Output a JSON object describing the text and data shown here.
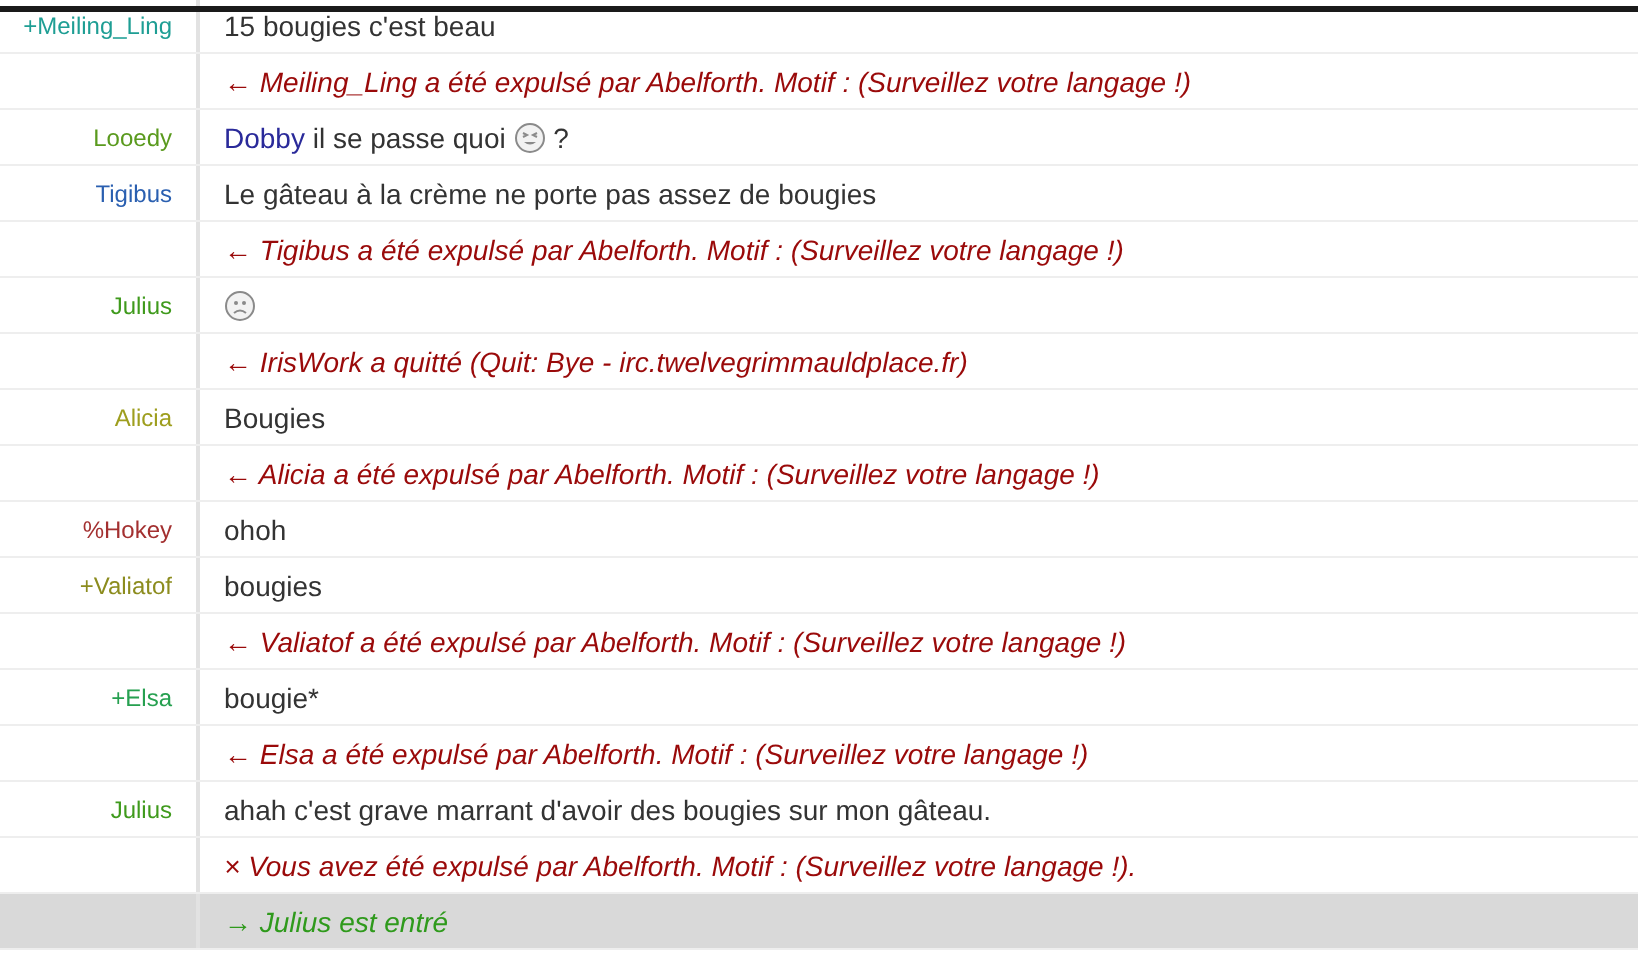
{
  "rows": [
    {
      "kind": "message",
      "nick": "+Meiling_Ling",
      "color": "#1e9e94",
      "parts": [
        {
          "kind": "text",
          "text": "15 bougies c'est beau"
        }
      ]
    },
    {
      "kind": "event",
      "parts": [
        {
          "kind": "text",
          "text": "← Meiling_Ling a été expulsé par Abelforth. Motif : (Surveillez votre langage !)"
        }
      ]
    },
    {
      "kind": "message",
      "nick": "Looedy",
      "color": "#5a9a1e",
      "parts": [
        {
          "kind": "mention",
          "text": "Dobby"
        },
        {
          "kind": "text",
          "text": " il se passe quoi "
        },
        {
          "kind": "squint"
        },
        {
          "kind": "text",
          "text": " ?"
        }
      ]
    },
    {
      "kind": "message",
      "nick": "Tigibus",
      "color": "#2a5fb0",
      "parts": [
        {
          "kind": "text",
          "text": "Le gâteau à la crème ne porte pas assez de bougies"
        }
      ]
    },
    {
      "kind": "event",
      "parts": [
        {
          "kind": "text",
          "text": "← Tigibus a été expulsé par Abelforth. Motif : (Surveillez votre langage !)"
        }
      ]
    },
    {
      "kind": "message",
      "nick": "Julius",
      "color": "#3f9a1c",
      "parts": [
        {
          "kind": "frown"
        }
      ]
    },
    {
      "kind": "event",
      "parts": [
        {
          "kind": "text",
          "text": "← IrisWork a quitté (Quit: Bye - irc.twelvegrimmauldplace.fr)"
        }
      ]
    },
    {
      "kind": "message",
      "nick": "Alicia",
      "color": "#9e9e1e",
      "parts": [
        {
          "kind": "text",
          "text": "Bougies"
        }
      ]
    },
    {
      "kind": "event",
      "parts": [
        {
          "kind": "text",
          "text": "← Alicia a été expulsé par Abelforth. Motif : (Surveillez votre langage !)"
        }
      ]
    },
    {
      "kind": "message",
      "nick": "%Hokey",
      "color": "#a33030",
      "parts": [
        {
          "kind": "text",
          "text": "ohoh"
        }
      ]
    },
    {
      "kind": "message",
      "nick": "+Valiatof",
      "color": "#8c8c1e",
      "parts": [
        {
          "kind": "text",
          "text": "bougies"
        }
      ]
    },
    {
      "kind": "event",
      "parts": [
        {
          "kind": "text",
          "text": "← Valiatof a été expulsé par Abelforth. Motif : (Surveillez votre langage !)"
        }
      ]
    },
    {
      "kind": "message",
      "nick": "+Elsa",
      "color": "#26a050",
      "parts": [
        {
          "kind": "text",
          "text": "bougie*"
        }
      ]
    },
    {
      "kind": "event",
      "parts": [
        {
          "kind": "text",
          "text": "← Elsa a été expulsé par Abelforth. Motif : (Surveillez votre langage !)"
        }
      ]
    },
    {
      "kind": "message",
      "nick": "Julius",
      "color": "#3f9a1c",
      "parts": [
        {
          "kind": "text",
          "text": "ahah c'est grave marrant d'avoir des bougies sur mon gâteau."
        }
      ]
    },
    {
      "kind": "event",
      "parts": [
        {
          "kind": "text",
          "text": "× Vous avez été expulsé par Abelforth. Motif : (Surveillez votre langage !)."
        }
      ]
    },
    {
      "kind": "join",
      "highlighted": true,
      "parts": [
        {
          "kind": "text",
          "text": "→ Julius est entré"
        }
      ]
    }
  ]
}
